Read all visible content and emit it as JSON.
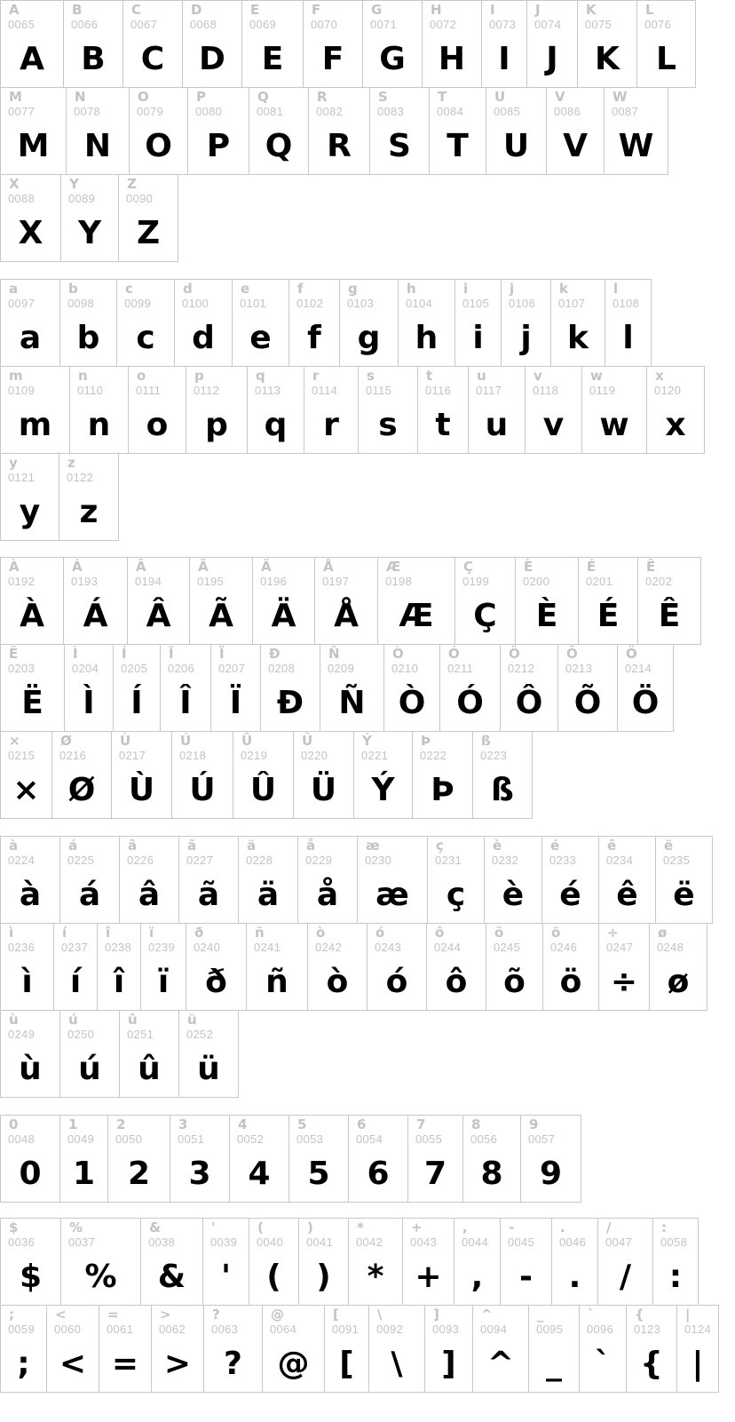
{
  "sections": [
    {
      "name": "uppercase",
      "rows": [
        [
          [
            "A",
            "0065"
          ],
          [
            "B",
            "0066"
          ],
          [
            "C",
            "0067"
          ],
          [
            "D",
            "0068"
          ],
          [
            "E",
            "0069"
          ],
          [
            "F",
            "0070"
          ],
          [
            "G",
            "0071"
          ],
          [
            "H",
            "0072"
          ],
          [
            "I",
            "0073"
          ],
          [
            "J",
            "0074"
          ],
          [
            "K",
            "0075"
          ],
          [
            "L",
            "0076"
          ]
        ],
        [
          [
            "M",
            "0077"
          ],
          [
            "N",
            "0078"
          ],
          [
            "O",
            "0079"
          ],
          [
            "P",
            "0080"
          ],
          [
            "Q",
            "0081"
          ],
          [
            "R",
            "0082"
          ],
          [
            "S",
            "0083"
          ],
          [
            "T",
            "0084"
          ],
          [
            "U",
            "0085"
          ],
          [
            "V",
            "0086"
          ],
          [
            "W",
            "0087"
          ]
        ],
        [
          [
            "X",
            "0088"
          ],
          [
            "Y",
            "0089"
          ],
          [
            "Z",
            "0090"
          ]
        ]
      ]
    },
    {
      "name": "lowercase",
      "rows": [
        [
          [
            "a",
            "0097"
          ],
          [
            "b",
            "0098"
          ],
          [
            "c",
            "0099"
          ],
          [
            "d",
            "0100"
          ],
          [
            "e",
            "0101"
          ],
          [
            "f",
            "0102"
          ],
          [
            "g",
            "0103"
          ],
          [
            "h",
            "0104"
          ],
          [
            "i",
            "0105"
          ],
          [
            "j",
            "0106"
          ],
          [
            "k",
            "0107"
          ],
          [
            "l",
            "0108"
          ]
        ],
        [
          [
            "m",
            "0109"
          ],
          [
            "n",
            "0110"
          ],
          [
            "o",
            "0111"
          ],
          [
            "p",
            "0112"
          ],
          [
            "q",
            "0113"
          ],
          [
            "r",
            "0114"
          ],
          [
            "s",
            "0115"
          ],
          [
            "t",
            "0116"
          ],
          [
            "u",
            "0117"
          ],
          [
            "v",
            "0118"
          ],
          [
            "w",
            "0119"
          ],
          [
            "x",
            "0120"
          ]
        ],
        [
          [
            "y",
            "0121"
          ],
          [
            "z",
            "0122"
          ]
        ]
      ]
    },
    {
      "name": "accented-uppercase",
      "rows": [
        [
          [
            "À",
            "0192"
          ],
          [
            "Á",
            "0193"
          ],
          [
            "Â",
            "0194"
          ],
          [
            "Ã",
            "0195"
          ],
          [
            "Ä",
            "0196"
          ],
          [
            "Å",
            "0197"
          ],
          [
            "Æ",
            "0198"
          ],
          [
            "Ç",
            "0199"
          ],
          [
            "È",
            "0200"
          ],
          [
            "É",
            "0201"
          ],
          [
            "Ê",
            "0202"
          ]
        ],
        [
          [
            "Ë",
            "0203"
          ],
          [
            "Ì",
            "0204"
          ],
          [
            "Í",
            "0205"
          ],
          [
            "Î",
            "0206"
          ],
          [
            "Ï",
            "0207"
          ],
          [
            "Ð",
            "0208"
          ],
          [
            "Ñ",
            "0209"
          ],
          [
            "Ò",
            "0210"
          ],
          [
            "Ó",
            "0211"
          ],
          [
            "Ô",
            "0212"
          ],
          [
            "Õ",
            "0213"
          ],
          [
            "Ö",
            "0214"
          ]
        ],
        [
          [
            "×",
            "0215"
          ],
          [
            "Ø",
            "0216"
          ],
          [
            "Ù",
            "0217"
          ],
          [
            "Ú",
            "0218"
          ],
          [
            "Û",
            "0219"
          ],
          [
            "Ü",
            "0220"
          ],
          [
            "Ý",
            "0221"
          ],
          [
            "Þ",
            "0222"
          ],
          [
            "ß",
            "0223"
          ]
        ]
      ]
    },
    {
      "name": "accented-lowercase",
      "rows": [
        [
          [
            "à",
            "0224"
          ],
          [
            "á",
            "0225"
          ],
          [
            "â",
            "0226"
          ],
          [
            "ã",
            "0227"
          ],
          [
            "ä",
            "0228"
          ],
          [
            "å",
            "0229"
          ],
          [
            "æ",
            "0230"
          ],
          [
            "ç",
            "0231"
          ],
          [
            "è",
            "0232"
          ],
          [
            "é",
            "0233"
          ],
          [
            "ê",
            "0234"
          ],
          [
            "ë",
            "0235"
          ]
        ],
        [
          [
            "ì",
            "0236"
          ],
          [
            "í",
            "0237"
          ],
          [
            "î",
            "0238"
          ],
          [
            "ï",
            "0239"
          ],
          [
            "ð",
            "0240"
          ],
          [
            "ñ",
            "0241"
          ],
          [
            "ò",
            "0242"
          ],
          [
            "ó",
            "0243"
          ],
          [
            "ô",
            "0244"
          ],
          [
            "õ",
            "0245"
          ],
          [
            "ö",
            "0246"
          ],
          [
            "÷",
            "0247"
          ],
          [
            "ø",
            "0248"
          ]
        ],
        [
          [
            "ù",
            "0249"
          ],
          [
            "ú",
            "0250"
          ],
          [
            "û",
            "0251"
          ],
          [
            "ü",
            "0252"
          ]
        ]
      ]
    },
    {
      "name": "digits",
      "rows": [
        [
          [
            "0",
            "0048"
          ],
          [
            "1",
            "0049"
          ],
          [
            "2",
            "0050"
          ],
          [
            "3",
            "0051"
          ],
          [
            "4",
            "0052"
          ],
          [
            "5",
            "0053"
          ],
          [
            "6",
            "0054"
          ],
          [
            "7",
            "0055"
          ],
          [
            "8",
            "0056"
          ],
          [
            "9",
            "0057"
          ]
        ]
      ]
    },
    {
      "name": "punctuation",
      "rows": [
        [
          [
            "$",
            "0036"
          ],
          [
            "%",
            "0037"
          ],
          [
            "&",
            "0038"
          ],
          [
            "'",
            "0039"
          ],
          [
            "(",
            "0040"
          ],
          [
            ")",
            "0041"
          ],
          [
            "*",
            "0042"
          ],
          [
            "+",
            "0043"
          ],
          [
            ",",
            "0044"
          ],
          [
            "-",
            "0045"
          ],
          [
            ".",
            "0046"
          ],
          [
            "/",
            "0047"
          ],
          [
            ":",
            "0058"
          ]
        ],
        [
          [
            ";",
            "0059"
          ],
          [
            "<",
            "0060"
          ],
          [
            "=",
            "0061"
          ],
          [
            ">",
            "0062"
          ],
          [
            "?",
            "0063"
          ],
          [
            "@",
            "0064"
          ],
          [
            "[",
            "0091"
          ],
          [
            "\\",
            "0092"
          ],
          [
            "]",
            "0093"
          ],
          [
            "^",
            "0094"
          ],
          [
            "_",
            "0095"
          ],
          [
            "`",
            "0096"
          ],
          [
            "{",
            "0123"
          ],
          [
            "|",
            "0124"
          ]
        ]
      ]
    }
  ]
}
